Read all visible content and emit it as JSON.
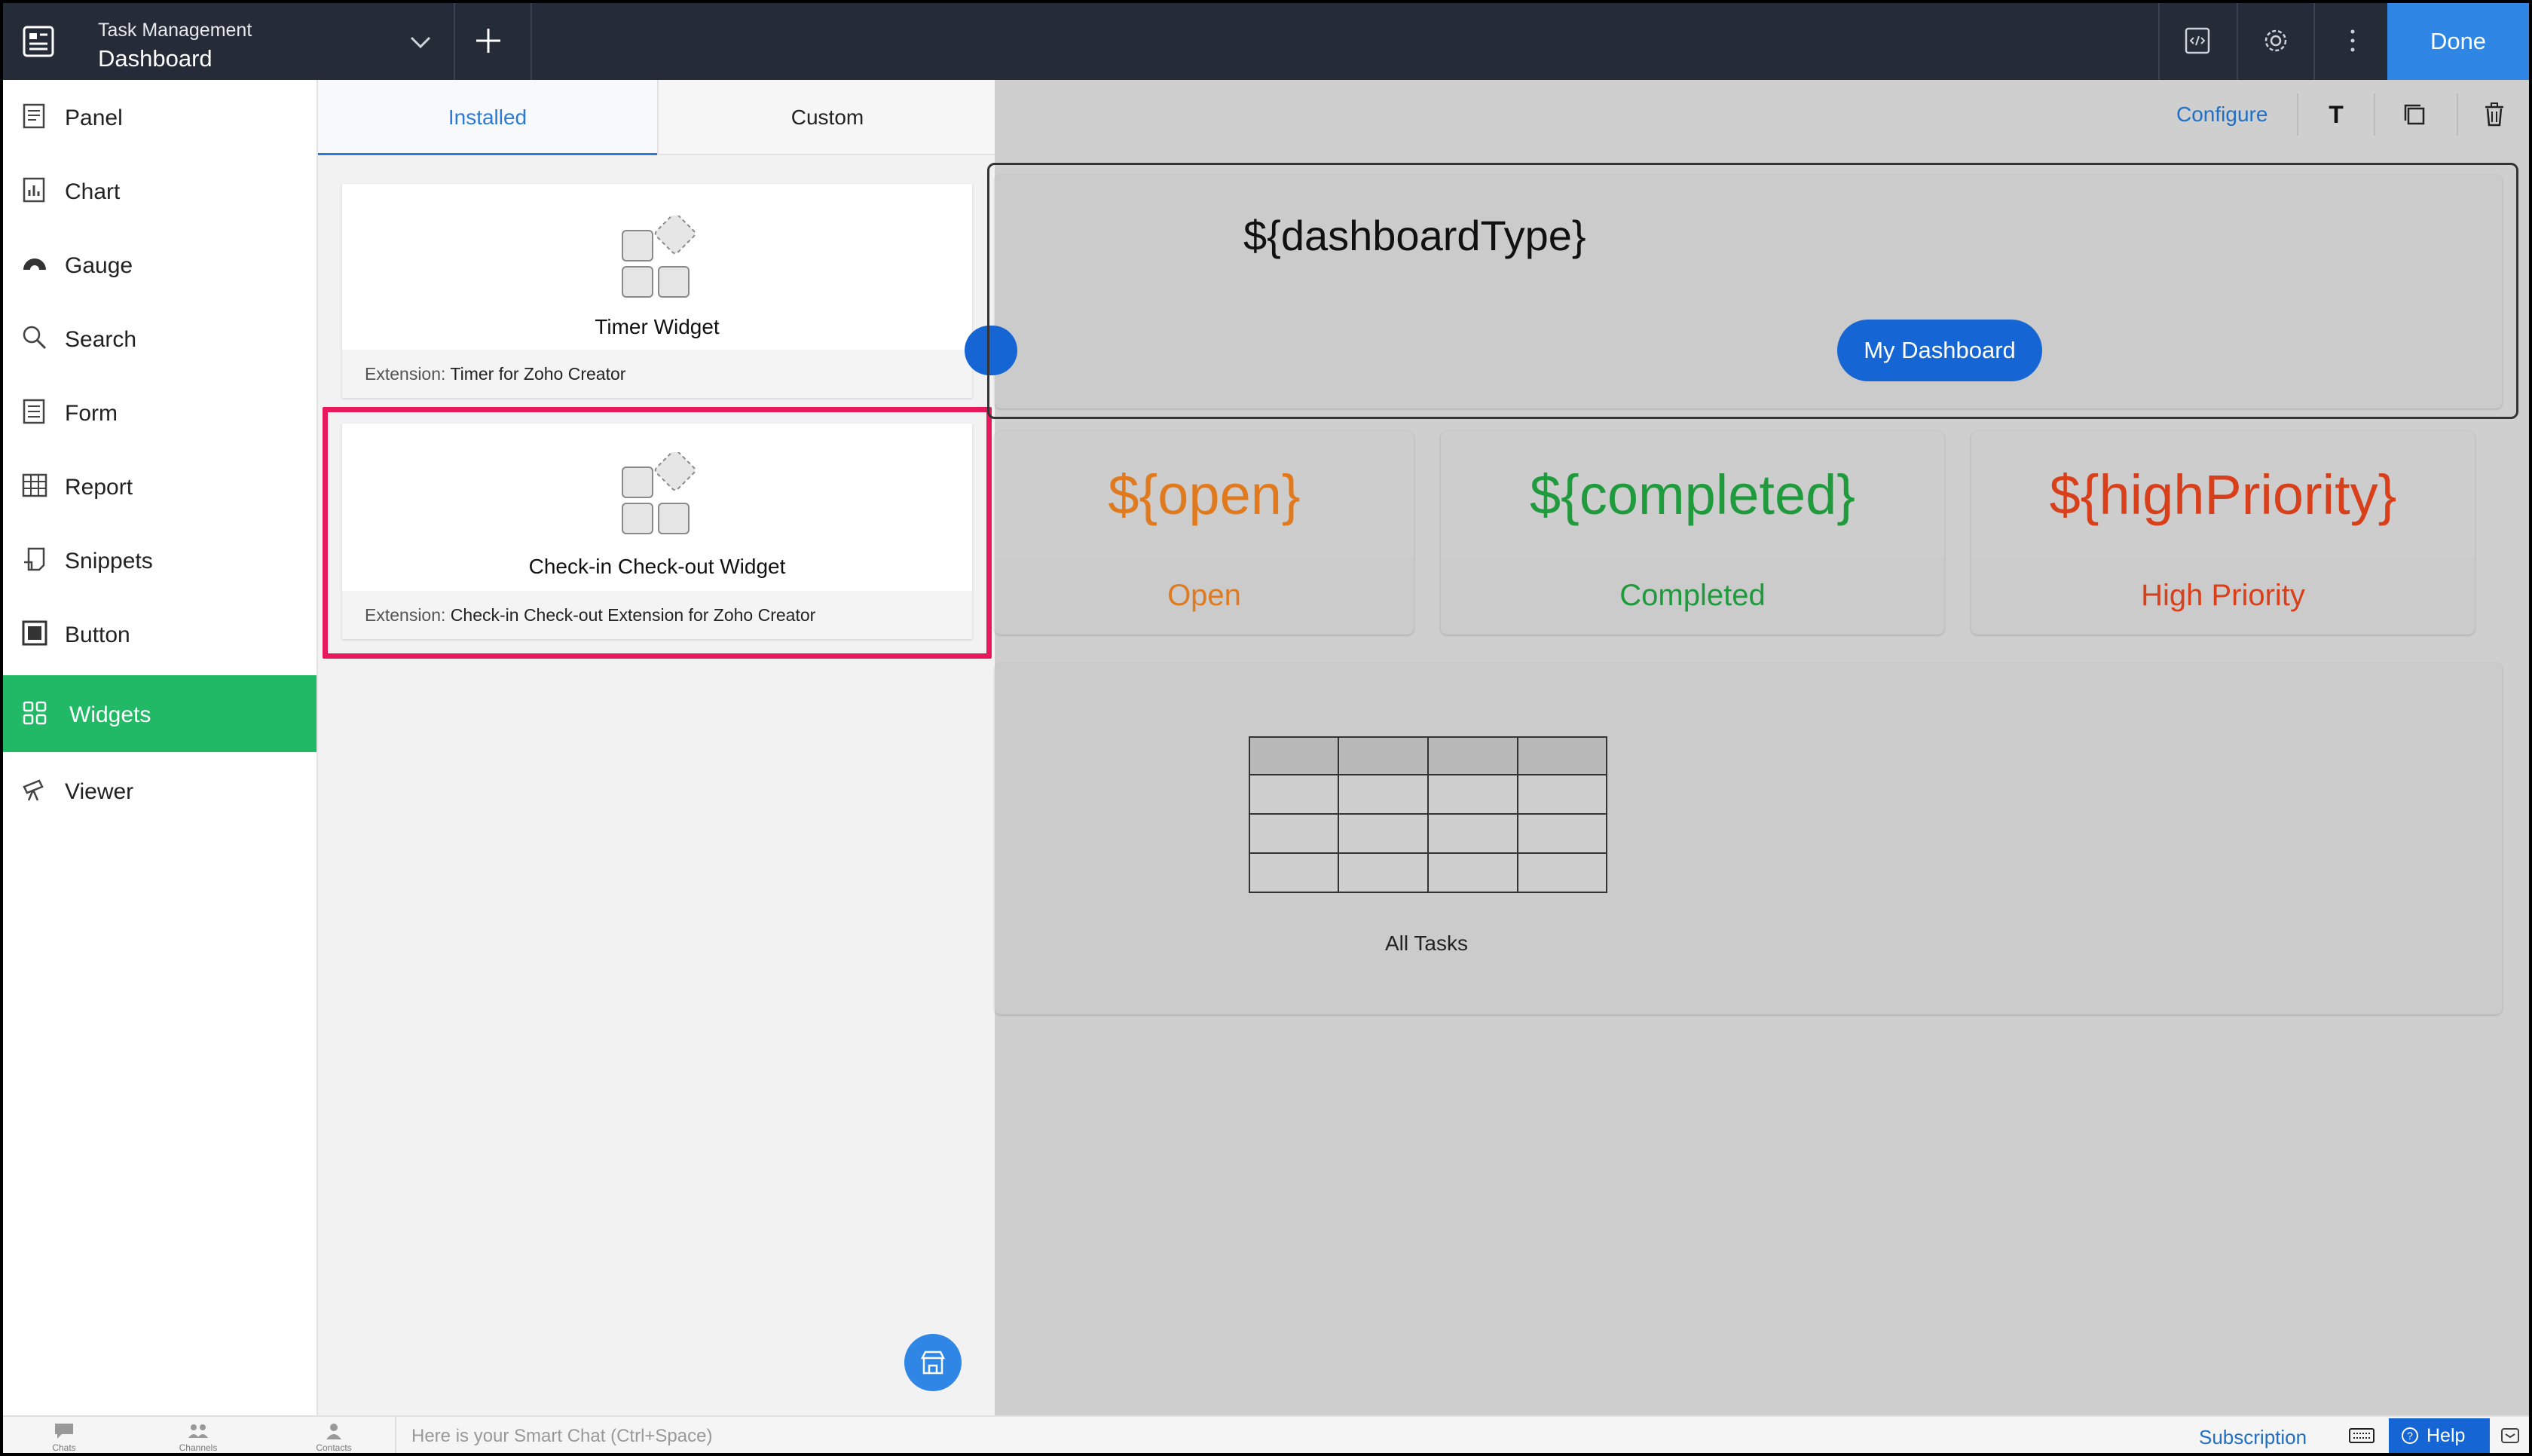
{
  "topbar": {
    "app_title": "Task Management",
    "page_name": "Dashboard",
    "done_label": "Done"
  },
  "nav": {
    "items": [
      {
        "label": "Panel",
        "icon": "panel-icon"
      },
      {
        "label": "Chart",
        "icon": "chart-icon"
      },
      {
        "label": "Gauge",
        "icon": "gauge-icon"
      },
      {
        "label": "Search",
        "icon": "search-icon"
      },
      {
        "label": "Form",
        "icon": "form-icon"
      },
      {
        "label": "Report",
        "icon": "report-icon"
      },
      {
        "label": "Snippets",
        "icon": "snippets-icon"
      },
      {
        "label": "Button",
        "icon": "button-icon"
      },
      {
        "label": "Widgets",
        "icon": "widgets-icon",
        "active": true
      },
      {
        "label": "Viewer",
        "icon": "viewer-icon"
      }
    ],
    "active_color": "#21b866"
  },
  "widget_panel": {
    "tabs": {
      "installed": "Installed",
      "custom": "Custom"
    },
    "cards": [
      {
        "title": "Timer Widget",
        "ext_label": "Extension:",
        "ext_value": "Timer for Zoho Creator"
      },
      {
        "title": "Check-in Check-out Widget",
        "ext_label": "Extension:",
        "ext_value": "Check-in Check-out Extension for Zoho Creator"
      }
    ],
    "highlight_color": "#e8185c"
  },
  "canvas": {
    "toolbar": {
      "configure": "Configure",
      "text_tool": "T"
    },
    "dashboard_type": "${dashboardType}",
    "my_dashboard": "My Dashboard",
    "stats": [
      {
        "value": "${open}",
        "label": "Open",
        "color": "#e07a1f"
      },
      {
        "value": "${completed}",
        "label": "Completed",
        "color": "#1f9a3c"
      },
      {
        "value": "${highPriority}",
        "label": "High Priority",
        "color": "#d8401c"
      }
    ],
    "tasks_label": "All Tasks"
  },
  "bottombar": {
    "tabs": [
      "Chats",
      "Channels",
      "Contacts"
    ],
    "chat_placeholder": "Here is your Smart Chat (Ctrl+Space)",
    "subscription": "Subscription",
    "help": "Help"
  }
}
